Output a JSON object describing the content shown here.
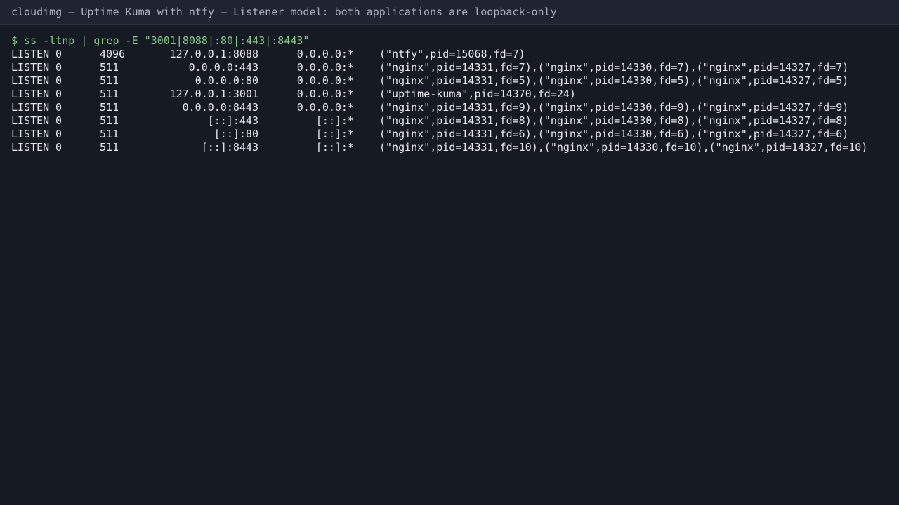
{
  "window": {
    "title": "cloudimg — Uptime Kuma with ntfy — Listener model: both applications are loopback-only"
  },
  "terminal": {
    "command": "$ ss -ltnp | grep -E \"3001|8088|:80|:443|:8443\"",
    "rows": [
      {
        "state": "LISTEN",
        "recv_q": "0",
        "send_q": "4096",
        "local": "127.0.0.1:8088",
        "peer": "0.0.0.0:*",
        "process": "(\"ntfy\",pid=15068,fd=7)"
      },
      {
        "state": "LISTEN",
        "recv_q": "0",
        "send_q": "511",
        "local": "0.0.0.0:443",
        "peer": "0.0.0.0:*",
        "process": "(\"nginx\",pid=14331,fd=7),(\"nginx\",pid=14330,fd=7),(\"nginx\",pid=14327,fd=7)"
      },
      {
        "state": "LISTEN",
        "recv_q": "0",
        "send_q": "511",
        "local": "0.0.0.0:80",
        "peer": "0.0.0.0:*",
        "process": "(\"nginx\",pid=14331,fd=5),(\"nginx\",pid=14330,fd=5),(\"nginx\",pid=14327,fd=5)"
      },
      {
        "state": "LISTEN",
        "recv_q": "0",
        "send_q": "511",
        "local": "127.0.0.1:3001",
        "peer": "0.0.0.0:*",
        "process": "(\"uptime-kuma\",pid=14370,fd=24)"
      },
      {
        "state": "LISTEN",
        "recv_q": "0",
        "send_q": "511",
        "local": "0.0.0.0:8443",
        "peer": "0.0.0.0:*",
        "process": "(\"nginx\",pid=14331,fd=9),(\"nginx\",pid=14330,fd=9),(\"nginx\",pid=14327,fd=9)"
      },
      {
        "state": "LISTEN",
        "recv_q": "0",
        "send_q": "511",
        "local": "[::]:443",
        "peer": "[::]:*",
        "process": "(\"nginx\",pid=14331,fd=8),(\"nginx\",pid=14330,fd=8),(\"nginx\",pid=14327,fd=8)"
      },
      {
        "state": "LISTEN",
        "recv_q": "0",
        "send_q": "511",
        "local": "[::]:80",
        "peer": "[::]:*",
        "process": "(\"nginx\",pid=14331,fd=6),(\"nginx\",pid=14330,fd=6),(\"nginx\",pid=14327,fd=6)"
      },
      {
        "state": "LISTEN",
        "recv_q": "0",
        "send_q": "511",
        "local": "[::]:8443",
        "peer": "[::]:*",
        "process": "(\"nginx\",pid=14331,fd=10),(\"nginx\",pid=14330,fd=10),(\"nginx\",pid=14327,fd=10)"
      }
    ]
  },
  "colors": {
    "background": "#161a22",
    "titlebar": "#1f2430",
    "title_text": "#a9b0bf",
    "command_text": "#86c98f",
    "output_text": "#e6e8ee"
  }
}
